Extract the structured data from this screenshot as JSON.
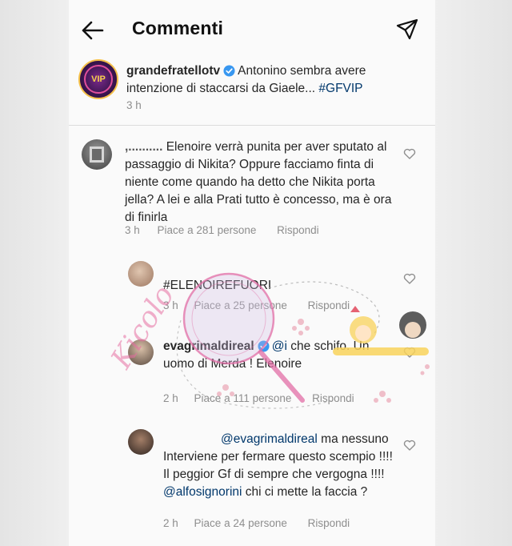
{
  "header": {
    "title": "Commenti"
  },
  "caption": {
    "username": "grandefratellotv",
    "text": "Antonino sembra avere intenzione di staccarsi da Giaele...",
    "hashtag": "#GFVIP",
    "time": "3 h",
    "avatar_logo": "VIP"
  },
  "comments": [
    {
      "username": ",..........",
      "text": "Elenoire verrà punita per aver sputato al passaggio di Nikita? Oppure facciamo finta di niente come quando ha detto che Nikita porta jella? A lei e alla Prati tutto è concesso, ma è ora di finirla",
      "time": "3 h",
      "likes": "Piace a 281 persone",
      "reply": "Rispondi"
    },
    {
      "username": "",
      "text": "#ELENOIREFUORI",
      "time": "3 h",
      "likes": "Piace a 25 persone",
      "reply": "Rispondi"
    },
    {
      "username": "evagrimaldireal",
      "mention": "@i",
      "text": "che schifo. Un uomo di Merda ! Elenoire",
      "time": "2 h",
      "likes": "Piace a 111 persone",
      "reply": "Rispondi"
    },
    {
      "username": "",
      "mention": "@evagrimaldireal",
      "text": "ma nessuno Interviene per fermare questo scempio !!!! Il peggior Gf di sempre che vergogna !!!!",
      "mention2": "@alfosignorini",
      "text2": "chi ci mette la faccia ?",
      "time": "2 h",
      "likes": "Piace a 24 persone",
      "reply": "Rispondi"
    }
  ],
  "watermark": {
    "text": "Kicolo"
  },
  "colors": {
    "meta": "#8e8e8e",
    "link": "#00376b",
    "verified": "#3897f0",
    "watermark": "#e66ea0"
  }
}
